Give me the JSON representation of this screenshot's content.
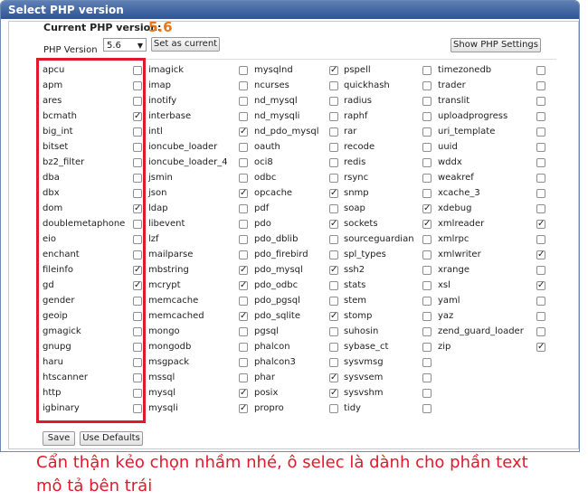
{
  "window": {
    "title": "Select PHP version"
  },
  "header": {
    "current_label": "Current PHP version:",
    "current_value": "5.6",
    "version_label": "PHP Version",
    "version_selected": "5.6",
    "set_current_label": "Set as current",
    "show_settings_label": "Show PHP Settings"
  },
  "columns": [
    [
      {
        "name": "apcu",
        "checked": false
      },
      {
        "name": "apm",
        "checked": false
      },
      {
        "name": "ares",
        "checked": false
      },
      {
        "name": "bcmath",
        "checked": true
      },
      {
        "name": "big_int",
        "checked": false
      },
      {
        "name": "bitset",
        "checked": false
      },
      {
        "name": "bz2_filter",
        "checked": false
      },
      {
        "name": "dba",
        "checked": false
      },
      {
        "name": "dbx",
        "checked": false
      },
      {
        "name": "dom",
        "checked": true
      },
      {
        "name": "doublemetaphone",
        "checked": false
      },
      {
        "name": "eio",
        "checked": false
      },
      {
        "name": "enchant",
        "checked": false
      },
      {
        "name": "fileinfo",
        "checked": true
      },
      {
        "name": "gd",
        "checked": true
      },
      {
        "name": "gender",
        "checked": false
      },
      {
        "name": "geoip",
        "checked": false
      },
      {
        "name": "gmagick",
        "checked": false
      },
      {
        "name": "gnupg",
        "checked": false
      },
      {
        "name": "haru",
        "checked": false
      },
      {
        "name": "htscanner",
        "checked": false
      },
      {
        "name": "http",
        "checked": false
      },
      {
        "name": "igbinary",
        "checked": false
      }
    ],
    [
      {
        "name": "imagick",
        "checked": false
      },
      {
        "name": "imap",
        "checked": false
      },
      {
        "name": "inotify",
        "checked": false
      },
      {
        "name": "interbase",
        "checked": false
      },
      {
        "name": "intl",
        "checked": true
      },
      {
        "name": "ioncube_loader",
        "checked": false
      },
      {
        "name": "ioncube_loader_4",
        "checked": false
      },
      {
        "name": "jsmin",
        "checked": false
      },
      {
        "name": "json",
        "checked": true
      },
      {
        "name": "ldap",
        "checked": false
      },
      {
        "name": "libevent",
        "checked": false
      },
      {
        "name": "lzf",
        "checked": false
      },
      {
        "name": "mailparse",
        "checked": false
      },
      {
        "name": "mbstring",
        "checked": true
      },
      {
        "name": "mcrypt",
        "checked": true
      },
      {
        "name": "memcache",
        "checked": false
      },
      {
        "name": "memcached",
        "checked": true
      },
      {
        "name": "mongo",
        "checked": false
      },
      {
        "name": "mongodb",
        "checked": false
      },
      {
        "name": "msgpack",
        "checked": false
      },
      {
        "name": "mssql",
        "checked": false
      },
      {
        "name": "mysql",
        "checked": true
      },
      {
        "name": "mysqli",
        "checked": true
      }
    ],
    [
      {
        "name": "mysqlnd",
        "checked": true
      },
      {
        "name": "ncurses",
        "checked": false
      },
      {
        "name": "nd_mysql",
        "checked": false
      },
      {
        "name": "nd_mysqli",
        "checked": false
      },
      {
        "name": "nd_pdo_mysql",
        "checked": false
      },
      {
        "name": "oauth",
        "checked": false
      },
      {
        "name": "oci8",
        "checked": false
      },
      {
        "name": "odbc",
        "checked": false
      },
      {
        "name": "opcache",
        "checked": true
      },
      {
        "name": "pdf",
        "checked": false
      },
      {
        "name": "pdo",
        "checked": true
      },
      {
        "name": "pdo_dblib",
        "checked": false
      },
      {
        "name": "pdo_firebird",
        "checked": false
      },
      {
        "name": "pdo_mysql",
        "checked": true
      },
      {
        "name": "pdo_odbc",
        "checked": false
      },
      {
        "name": "pdo_pgsql",
        "checked": false
      },
      {
        "name": "pdo_sqlite",
        "checked": true
      },
      {
        "name": "pgsql",
        "checked": false
      },
      {
        "name": "phalcon",
        "checked": false
      },
      {
        "name": "phalcon3",
        "checked": false
      },
      {
        "name": "phar",
        "checked": true
      },
      {
        "name": "posix",
        "checked": true
      },
      {
        "name": "propro",
        "checked": false
      }
    ],
    [
      {
        "name": "pspell",
        "checked": false
      },
      {
        "name": "quickhash",
        "checked": false
      },
      {
        "name": "radius",
        "checked": false
      },
      {
        "name": "raphf",
        "checked": false
      },
      {
        "name": "rar",
        "checked": false
      },
      {
        "name": "recode",
        "checked": false
      },
      {
        "name": "redis",
        "checked": false
      },
      {
        "name": "rsync",
        "checked": false
      },
      {
        "name": "snmp",
        "checked": false
      },
      {
        "name": "soap",
        "checked": true
      },
      {
        "name": "sockets",
        "checked": true
      },
      {
        "name": "sourceguardian",
        "checked": false
      },
      {
        "name": "spl_types",
        "checked": false
      },
      {
        "name": "ssh2",
        "checked": false
      },
      {
        "name": "stats",
        "checked": false
      },
      {
        "name": "stem",
        "checked": false
      },
      {
        "name": "stomp",
        "checked": false
      },
      {
        "name": "suhosin",
        "checked": false
      },
      {
        "name": "sybase_ct",
        "checked": false
      },
      {
        "name": "sysvmsg",
        "checked": false
      },
      {
        "name": "sysvsem",
        "checked": false
      },
      {
        "name": "sysvshm",
        "checked": false
      },
      {
        "name": "tidy",
        "checked": false
      }
    ],
    [
      {
        "name": "timezonedb",
        "checked": false
      },
      {
        "name": "trader",
        "checked": false
      },
      {
        "name": "translit",
        "checked": false
      },
      {
        "name": "uploadprogress",
        "checked": false
      },
      {
        "name": "uri_template",
        "checked": false
      },
      {
        "name": "uuid",
        "checked": false
      },
      {
        "name": "wddx",
        "checked": false
      },
      {
        "name": "weakref",
        "checked": false
      },
      {
        "name": "xcache_3",
        "checked": false
      },
      {
        "name": "xdebug",
        "checked": false
      },
      {
        "name": "xmlreader",
        "checked": true
      },
      {
        "name": "xmlrpc",
        "checked": false
      },
      {
        "name": "xmlwriter",
        "checked": true
      },
      {
        "name": "xrange",
        "checked": false
      },
      {
        "name": "xsl",
        "checked": true
      },
      {
        "name": "yaml",
        "checked": false
      },
      {
        "name": "yaz",
        "checked": false
      },
      {
        "name": "zend_guard_loader",
        "checked": false
      },
      {
        "name": "zip",
        "checked": true
      }
    ]
  ],
  "footer": {
    "save_label": "Save",
    "defaults_label": "Use Defaults"
  },
  "note": {
    "line1": "Cẩn thận kẻo chọn nhầm nhé, ô selec là dành cho phần text",
    "line2": "mô tả bên trái"
  },
  "colors": {
    "accent": "#e8761a",
    "annotation": "#e0192b",
    "titlebar": "#2f5494"
  }
}
